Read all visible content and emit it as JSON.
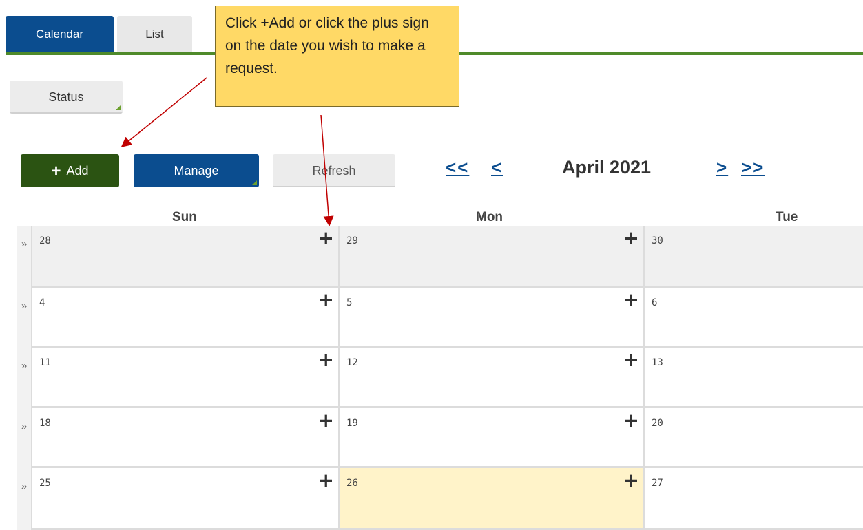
{
  "tabs": [
    {
      "label": "Calendar",
      "active": true
    },
    {
      "label": "List",
      "active": false
    }
  ],
  "buttons": {
    "status": "Status",
    "add": "Add",
    "add_icon": "+",
    "manage": "Manage",
    "refresh": "Refresh"
  },
  "navigation": {
    "first": "<<",
    "prev": "<",
    "next": ">",
    "last": ">>",
    "month_title": "April 2021"
  },
  "weekdays": [
    "Sun",
    "Mon",
    "Tue"
  ],
  "week_marker": "»",
  "plus_icon": "+",
  "weeks": [
    {
      "days": [
        "28",
        "29",
        "30"
      ]
    },
    {
      "days": [
        "4",
        "5",
        "6"
      ]
    },
    {
      "days": [
        "11",
        "12",
        "13"
      ]
    },
    {
      "days": [
        "18",
        "19",
        "20"
      ]
    },
    {
      "days": [
        "25",
        "26",
        "27"
      ]
    }
  ],
  "highlighted_day": "26",
  "callout": {
    "text": "Click +Add or click the plus sign on the date you wish to make a request."
  },
  "colors": {
    "primary_blue": "#0b4d8f",
    "add_green": "#2b5312",
    "rule_green": "#4f8a2a",
    "today_yellow": "#fff3c9",
    "callout_yellow": "#ffd966",
    "arrow_red": "#c00000"
  }
}
